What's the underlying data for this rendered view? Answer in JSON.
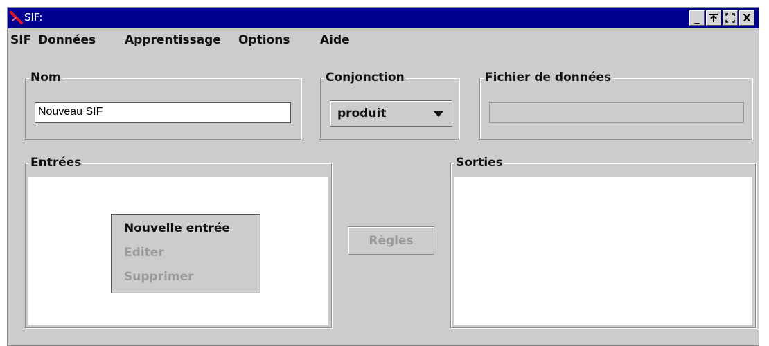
{
  "window": {
    "title": "SIF:",
    "title_bar_color": "#00008e",
    "icon": "app-logo-icon",
    "controls": {
      "minimize": "_",
      "maximize": "⊼",
      "restore": "⛶",
      "close": "X"
    }
  },
  "menubar": {
    "items": [
      "SIF",
      "Données",
      "Apprentissage",
      "Options",
      "Aide"
    ]
  },
  "nom": {
    "label": "Nom",
    "value": "Nouveau SIF"
  },
  "conjonction": {
    "label": "Conjonction",
    "selected": "produit"
  },
  "fichier": {
    "label": "Fichier de données",
    "value": ""
  },
  "entrees": {
    "label": "Entrées",
    "context_menu": [
      {
        "label": "Nouvelle entrée",
        "enabled": true
      },
      {
        "label": "Editer",
        "enabled": false
      },
      {
        "label": "Supprimer",
        "enabled": false
      }
    ]
  },
  "regles_button": {
    "label": "Règles",
    "enabled": false
  },
  "sorties": {
    "label": "Sorties"
  }
}
